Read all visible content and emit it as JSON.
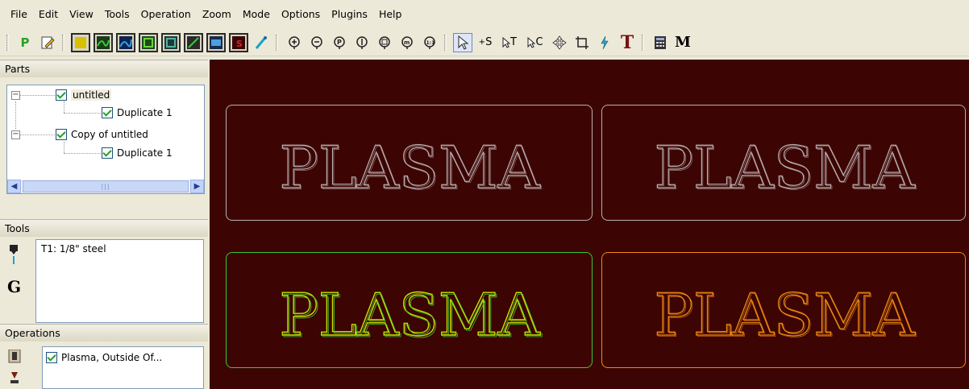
{
  "menu": {
    "items": [
      "File",
      "Edit",
      "View",
      "Tools",
      "Operation",
      "Zoom",
      "Mode",
      "Options",
      "Plugins",
      "Help"
    ]
  },
  "toolbar": {
    "p_label": "P",
    "m_label": "M",
    "t_label": "T",
    "select_s": "S",
    "select_t": "T",
    "select_c": "C"
  },
  "parts": {
    "title": "Parts",
    "items": [
      {
        "label": "untitled",
        "child": "Duplicate 1"
      },
      {
        "label": "Copy of  untitled",
        "child": "Duplicate 1"
      }
    ]
  },
  "tools": {
    "title": "Tools",
    "items": [
      "T1: 1/8\" steel"
    ],
    "gcode_label": "G"
  },
  "operations": {
    "title": "Operations",
    "items": [
      "Plasma, Outside Of..."
    ]
  },
  "canvas": {
    "plate_text": "PLASMA",
    "colors": {
      "background": "#3c0503",
      "unselected": "#b9b0b0",
      "selected_green": "#41c631",
      "orange": "#f08a10"
    }
  }
}
